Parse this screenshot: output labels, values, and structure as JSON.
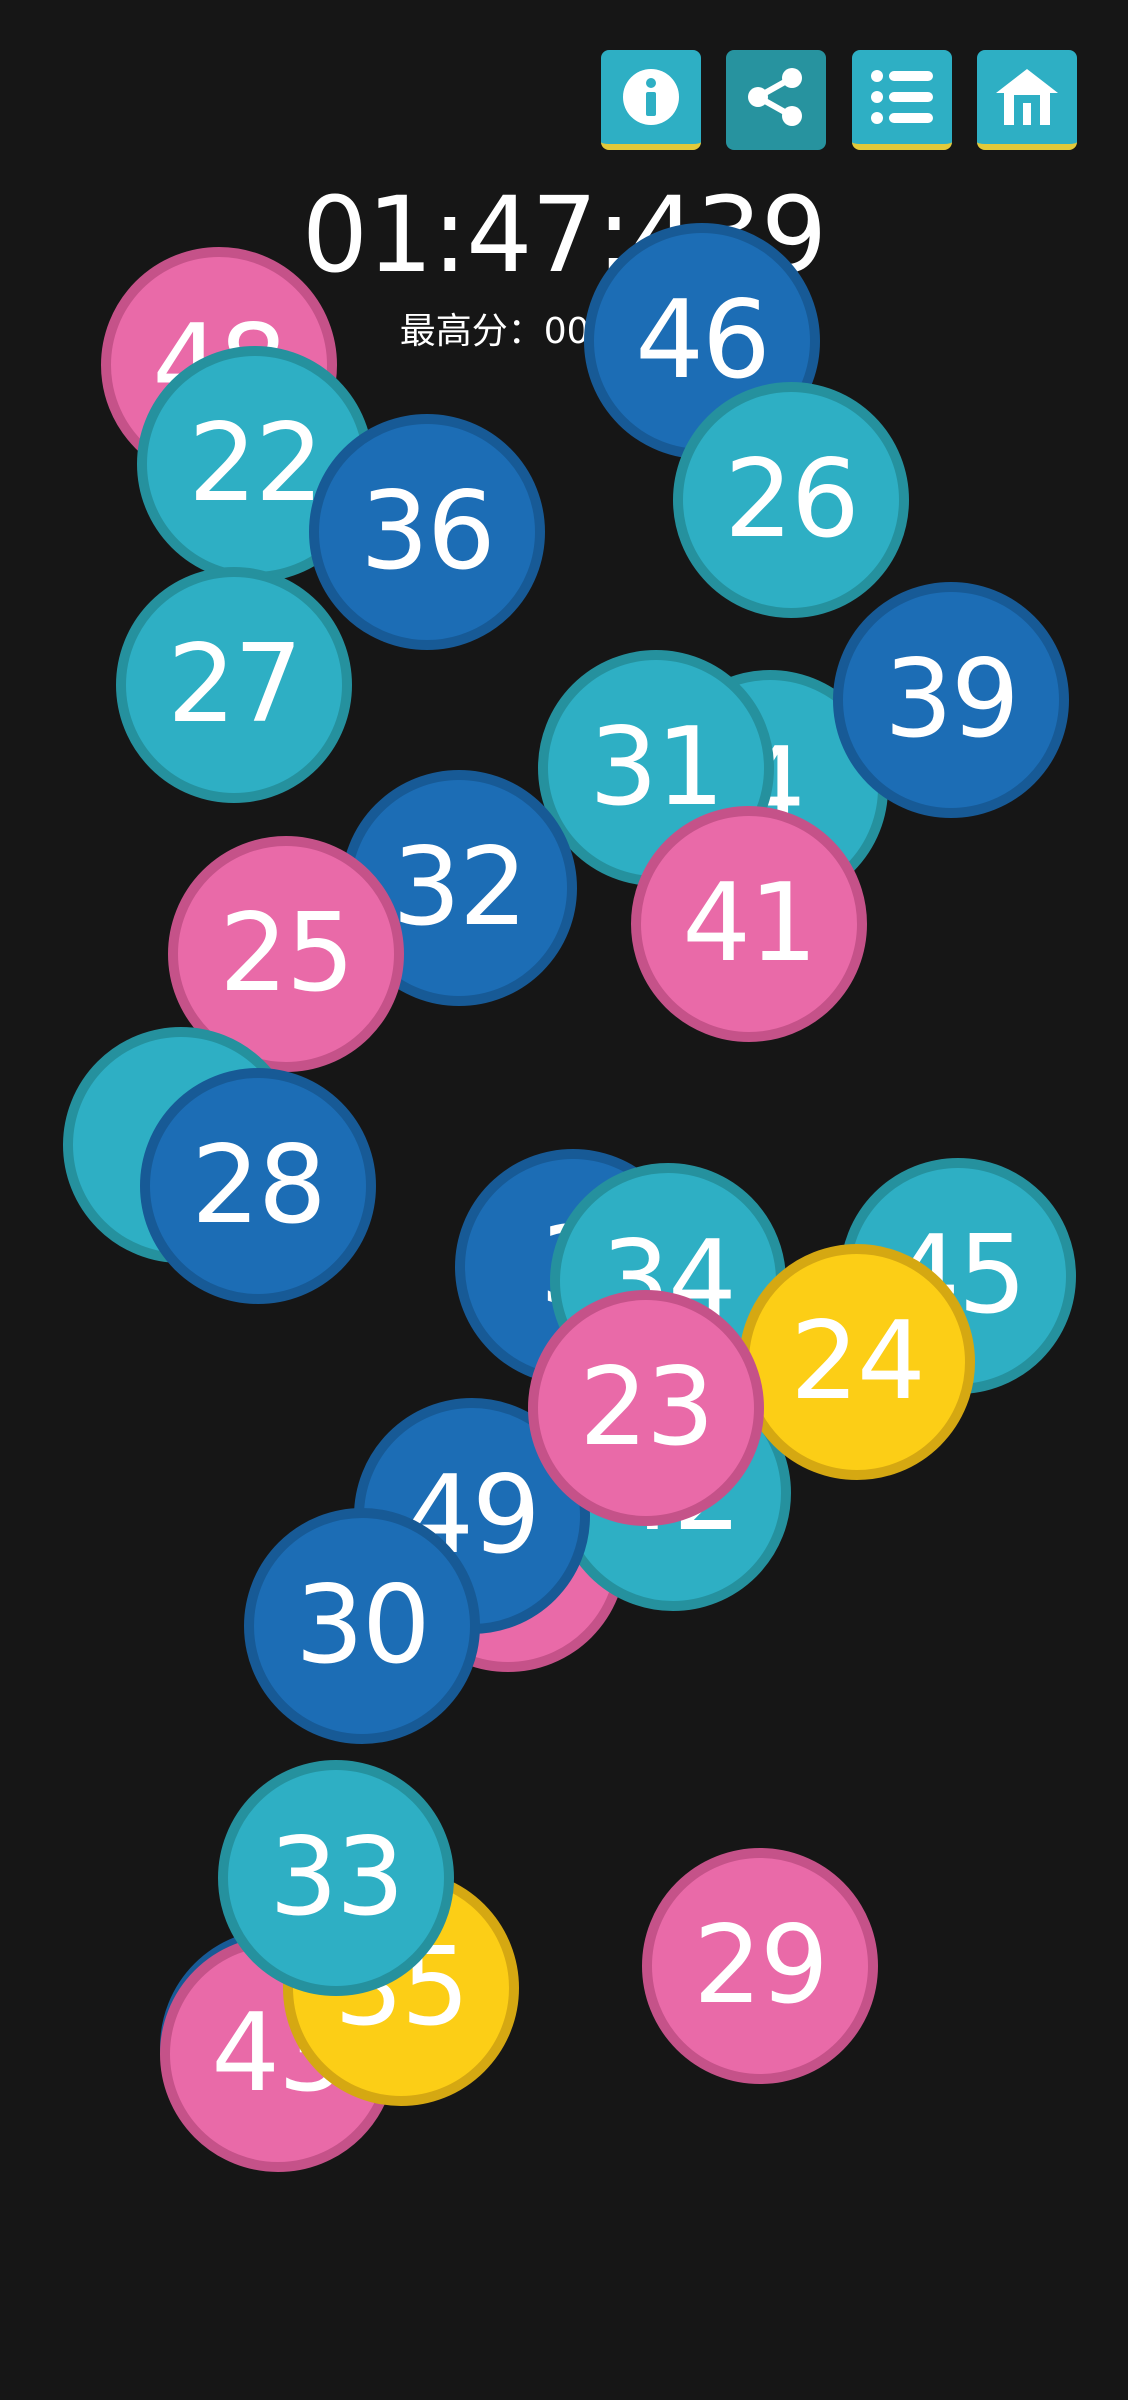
{
  "header": {
    "timer": "01:47:439",
    "best_score": "最高分：00:50:166"
  },
  "toolbar": {
    "buttons": [
      {
        "name": "info-button",
        "icon": "info-icon",
        "bg": "#2eafc4"
      },
      {
        "name": "share-button",
        "icon": "share-icon",
        "bg": "#27939f"
      },
      {
        "name": "list-button",
        "icon": "list-icon",
        "bg": "#2eafc4"
      },
      {
        "name": "home-button",
        "icon": "home-icon",
        "bg": "#2eafc4"
      }
    ]
  },
  "colors": {
    "background": "#161616",
    "teal": "#2eafc4",
    "teal_border": "#25919e",
    "blue": "#1c6db5",
    "blue_border": "#175a96",
    "pink": "#e96aa8",
    "pink_border": "#c55289",
    "yellow": "#fcce16",
    "yellow_border": "#d5a812",
    "button_underline": "#e2c93a"
  },
  "bubbles": [
    {
      "label": "48",
      "color": "pink"
    },
    {
      "label": "46",
      "color": "blue"
    },
    {
      "label": "22",
      "color": "teal"
    },
    {
      "label": "36",
      "color": "blue"
    },
    {
      "label": "26",
      "color": "teal"
    },
    {
      "label": "27",
      "color": "teal"
    },
    {
      "label": "4",
      "color": "teal"
    },
    {
      "label": "39",
      "color": "blue"
    },
    {
      "label": "31",
      "color": "teal"
    },
    {
      "label": "32",
      "color": "blue"
    },
    {
      "label": "41",
      "color": "pink"
    },
    {
      "label": "25",
      "color": "pink"
    },
    {
      "label": "4",
      "color": "teal"
    },
    {
      "label": "28",
      "color": "blue"
    },
    {
      "label": "3",
      "color": "blue"
    },
    {
      "label": "45",
      "color": "teal"
    },
    {
      "label": "34",
      "color": "teal"
    },
    {
      "label": "",
      "color": "pink"
    },
    {
      "label": "42",
      "color": "teal"
    },
    {
      "label": "49",
      "color": "blue"
    },
    {
      "label": "24",
      "color": "yellow"
    },
    {
      "label": "23",
      "color": "pink"
    },
    {
      "label": "30",
      "color": "blue"
    },
    {
      "label": "",
      "color": "blue"
    },
    {
      "label": "43",
      "color": "pink"
    },
    {
      "label": "35",
      "color": "yellow"
    },
    {
      "label": "33",
      "color": "teal"
    },
    {
      "label": "29",
      "color": "pink"
    }
  ]
}
